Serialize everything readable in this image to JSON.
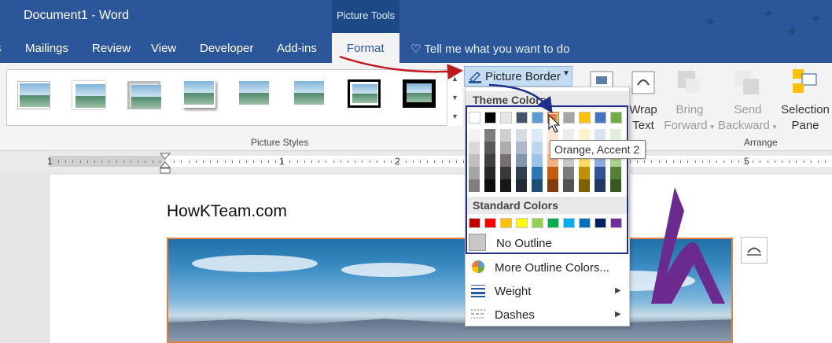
{
  "window": {
    "title": "Document1 - Word",
    "context_tab_group": "Picture Tools"
  },
  "tabs": [
    "Mailings",
    "Review",
    "View",
    "Developer",
    "Add-ins"
  ],
  "active_tab": "Format",
  "tell_me": "Tell me what you want to do",
  "ribbon": {
    "picture_styles_label": "Picture Styles",
    "picture_border_label": "Picture Border",
    "wrap_text": [
      "Wrap",
      "Text"
    ],
    "bring_forward": [
      "Bring",
      "Forward"
    ],
    "send_backward": [
      "Send",
      "Backward"
    ],
    "selection_pane": [
      "Selection",
      "Pane"
    ],
    "arrange_label": "Arrange"
  },
  "ruler": {
    "numbers": [
      "1",
      "1",
      "2",
      "5"
    ]
  },
  "document": {
    "heading": "HowKTeam.com"
  },
  "dropdown": {
    "theme_colors_header": "Theme Colors",
    "standard_colors_header": "Standard Colors",
    "no_outline": "No Outline",
    "more_outline_colors": "More Outline Colors...",
    "weight": "Weight",
    "dashes": "Dashes",
    "tooltip": "Orange, Accent 2",
    "theme_top_colors": [
      "#ffffff",
      "#000000",
      "#e7e6e6",
      "#44546a",
      "#5b9bd5",
      "#ed7d31",
      "#a5a5a5",
      "#ffc000",
      "#4472c4",
      "#70ad47"
    ],
    "theme_shade_columns": [
      [
        "#f2f2f2",
        "#d9d9d9",
        "#bfbfbf",
        "#a6a6a6",
        "#7f7f7f"
      ],
      [
        "#7f7f7f",
        "#595959",
        "#3f3f3f",
        "#262626",
        "#0d0d0d"
      ],
      [
        "#d0cece",
        "#aeabab",
        "#757171",
        "#3a3838",
        "#171616"
      ],
      [
        "#d6dce4",
        "#adb9ca",
        "#8497b0",
        "#323f4f",
        "#222a35"
      ],
      [
        "#ddebf7",
        "#bdd7ee",
        "#9dc3e6",
        "#2e75b6",
        "#1f4e79"
      ],
      [
        "#fbe5d6",
        "#f8cbad",
        "#f4b183",
        "#c55a11",
        "#843c0c"
      ],
      [
        "#ededed",
        "#dbdbdb",
        "#c9c9c9",
        "#7b7b7b",
        "#525252"
      ],
      [
        "#fff2cc",
        "#ffe699",
        "#ffd966",
        "#bf9000",
        "#7f6000"
      ],
      [
        "#dae3f3",
        "#b4c7e7",
        "#8faadc",
        "#2f5597",
        "#1f3864"
      ],
      [
        "#e2f0d9",
        "#c5e0b4",
        "#a9d18e",
        "#548235",
        "#385723"
      ]
    ],
    "standard_colors": [
      "#c00000",
      "#ff0000",
      "#ffc000",
      "#ffff00",
      "#92d050",
      "#00b050",
      "#00b0f0",
      "#0070c0",
      "#002060",
      "#7030a0"
    ]
  }
}
